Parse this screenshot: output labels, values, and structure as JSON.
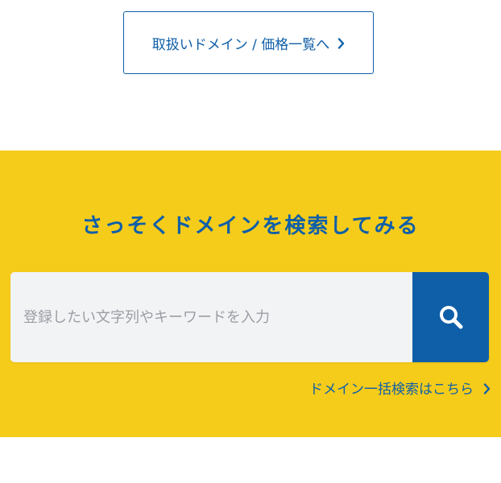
{
  "domain_list_button": {
    "label": "取扱いドメイン / 価格一覧へ",
    "icon": "chevron-right-icon"
  },
  "search_section": {
    "background_color": "#f6cc1a",
    "accent_color": "#0f5fa8",
    "title": "さっそくドメインを検索してみる",
    "input": {
      "value": "",
      "placeholder": "登録したい文字列やキーワードを入力"
    },
    "search_button": {
      "icon": "search-icon"
    },
    "bulk_link": {
      "label": "ドメイン一括検索はこちら",
      "icon": "chevron-right-icon"
    }
  }
}
